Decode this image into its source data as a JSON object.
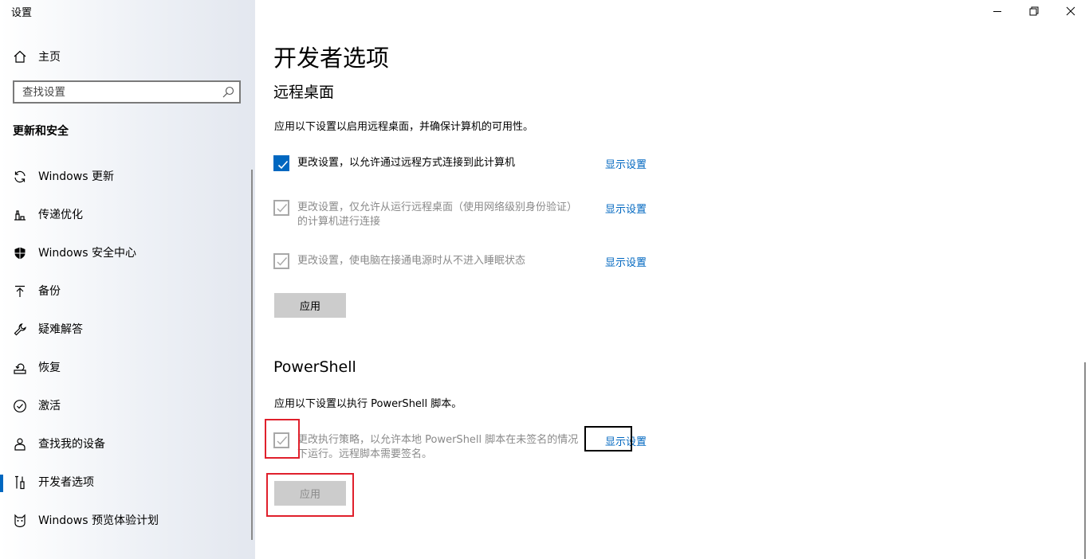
{
  "window": {
    "title": "设置"
  },
  "sidebar": {
    "home_label": "主页",
    "search_placeholder": "查找设置",
    "section_title": "更新和安全",
    "items": [
      {
        "label": "Windows 更新",
        "icon": "sync-icon"
      },
      {
        "label": "传递优化",
        "icon": "delivery-optimization-icon"
      },
      {
        "label": "Windows 安全中心",
        "icon": "shield-icon"
      },
      {
        "label": "备份",
        "icon": "backup-arrow-icon"
      },
      {
        "label": "疑难解答",
        "icon": "wrench-icon"
      },
      {
        "label": "恢复",
        "icon": "recovery-icon"
      },
      {
        "label": "激活",
        "icon": "check-circle-icon"
      },
      {
        "label": "查找我的设备",
        "icon": "person-pin-icon"
      },
      {
        "label": "开发者选项",
        "icon": "developer-tools-icon",
        "active": true
      },
      {
        "label": "Windows 预览体验计划",
        "icon": "insider-cat-icon"
      }
    ]
  },
  "main": {
    "page_title": "开发者选项",
    "remote_desktop": {
      "heading": "远程桌面",
      "description": "应用以下设置以启用远程桌面，并确保计算机的可用性。",
      "options": [
        {
          "text": "更改设置，以允许通过远程方式连接到此计算机",
          "checked": true,
          "disabled": false,
          "link": "显示设置"
        },
        {
          "text": "更改设置，仅允许从运行远程桌面（使用网络级别身份验证）的计算机进行连接",
          "checked": true,
          "disabled": true,
          "link": "显示设置"
        },
        {
          "text": "更改设置，使电脑在接通电源时从不进入睡眠状态",
          "checked": true,
          "disabled": true,
          "link": "显示设置"
        }
      ],
      "apply_label": "应用"
    },
    "powershell": {
      "heading": "PowerShell",
      "description": "应用以下设置以执行 PowerShell 脚本。",
      "options": [
        {
          "text": "更改执行策略，以允许本地 PowerShell 脚本在未签名的情况下运行。远程脚本需要签名。",
          "checked": true,
          "disabled": true,
          "link": "显示设置"
        }
      ],
      "apply_label": "应用"
    }
  },
  "colors": {
    "accent": "#0067c0",
    "highlight": "#e0202c"
  }
}
